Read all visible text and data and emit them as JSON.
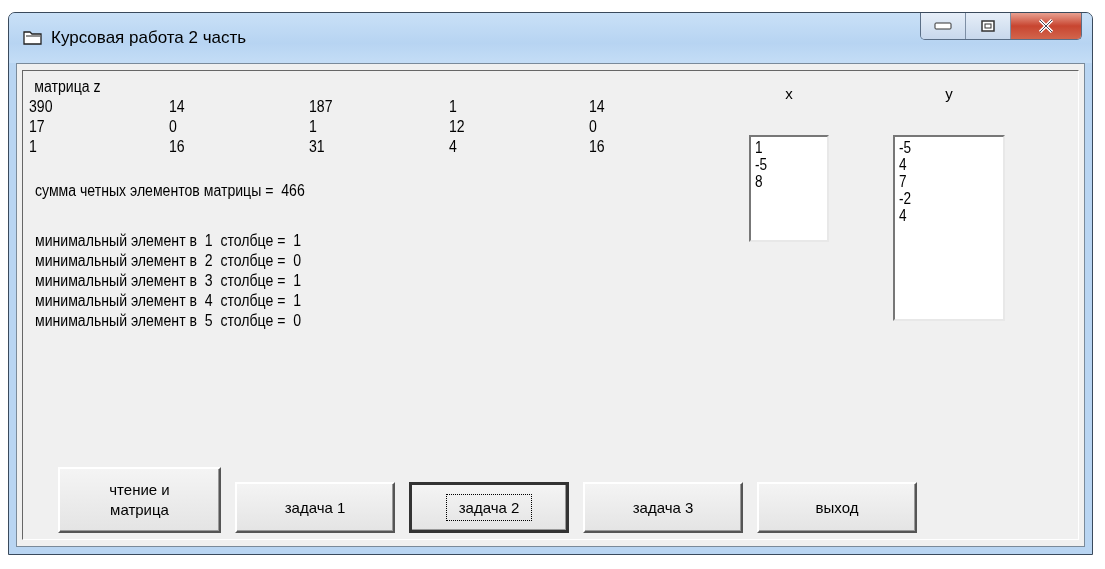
{
  "window": {
    "title": "Курсовая работа 2 часть"
  },
  "matrix": {
    "label": "матрица z",
    "rows": [
      [
        "390",
        "14",
        "187",
        "1",
        "14"
      ],
      [
        "17",
        "0",
        "1",
        "12",
        "0"
      ],
      [
        "1",
        "16",
        "31",
        "4",
        "16"
      ]
    ]
  },
  "sum_line": "сумма четных элементов матрицы =  466",
  "min_lines": [
    "минимальный элемент в  1  столбце =  1",
    "минимальный элемент в  2  столбце =  0",
    "минимальный элемент в  3  столбце =  1",
    "минимальный элемент в  4  столбце =  1",
    "минимальный элемент в  5  столбце =  0"
  ],
  "lists": [
    {
      "label": "x",
      "items": [
        "1",
        "-5",
        "8"
      ],
      "kind": "short"
    },
    {
      "label": "y",
      "items": [
        "-5",
        "4",
        "7",
        "-2",
        "4"
      ],
      "kind": "tall"
    }
  ],
  "buttons": [
    {
      "label": "чтение и матрица",
      "focused": false,
      "kind": "tall"
    },
    {
      "label": "задача 1",
      "focused": false,
      "kind": "normal"
    },
    {
      "label": "задача 2",
      "focused": true,
      "kind": "normal"
    },
    {
      "label": "задача 3",
      "focused": false,
      "kind": "normal"
    },
    {
      "label": "выход",
      "focused": false,
      "kind": "normal"
    }
  ]
}
